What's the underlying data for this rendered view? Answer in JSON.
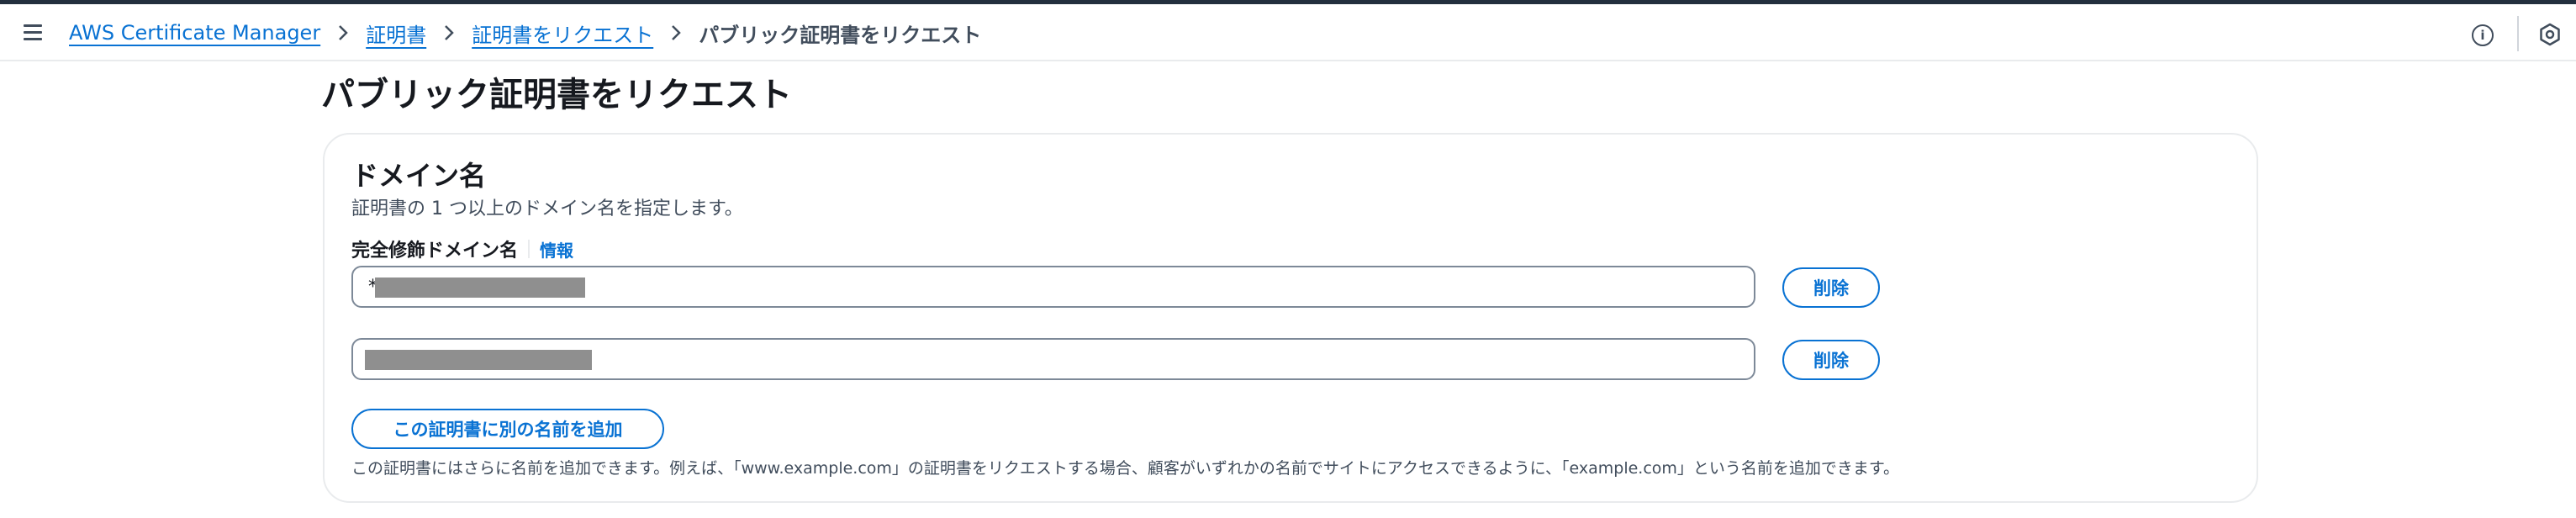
{
  "breadcrumb": {
    "items": [
      {
        "label": "AWS Certificate Manager"
      },
      {
        "label": "証明書"
      },
      {
        "label": "証明書をリクエスト"
      }
    ],
    "current": "パブリック証明書をリクエスト"
  },
  "page": {
    "title": "パブリック証明書をリクエスト"
  },
  "domain_section": {
    "title": "ドメイン名",
    "description": "証明書の 1 つ以上のドメイン名を指定します。",
    "field_label": "完全修飾ドメイン名",
    "info_link": "情報",
    "inputs": [
      {
        "value": "*."
      },
      {
        "value": ""
      }
    ],
    "delete_label": "削除",
    "add_button": "この証明書に別の名前を追加",
    "hint": "この証明書にはさらに名前を追加できます。例えば、「www.example.com」の証明書をリクエストする場合、顧客がいずれかの名前でサイトにアクセスできるように、「example.com」という名前を追加できます。"
  },
  "icons": {
    "menu": "hamburger-menu-icon",
    "separator": "chevron-right-icon",
    "info": "info-circle-icon",
    "feedback": "hexagon-icon"
  },
  "colors": {
    "link": "#0972d3",
    "text": "#16191f",
    "secondary_text": "#414d5c",
    "border": "#7d8998",
    "top_bar": "#232f3e"
  }
}
